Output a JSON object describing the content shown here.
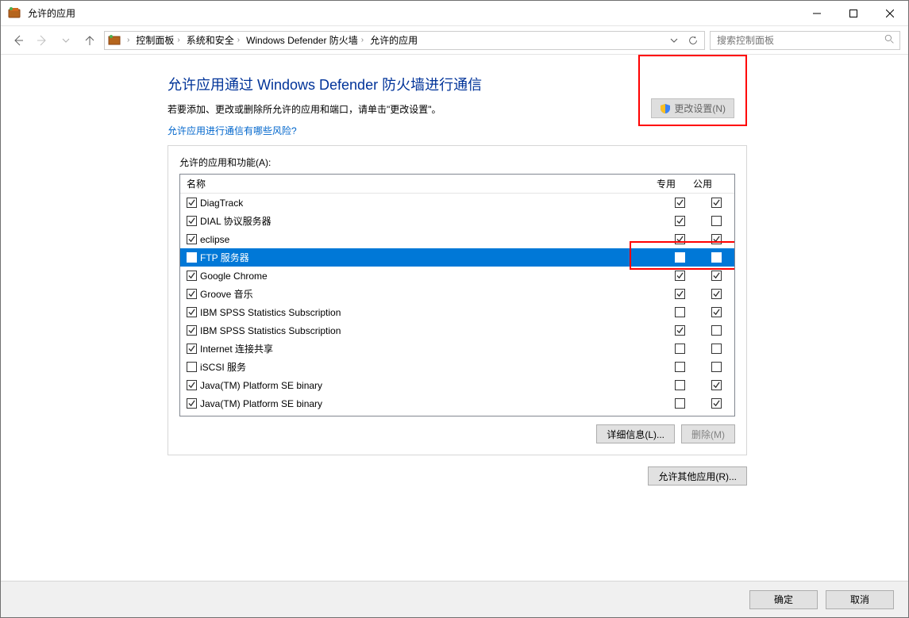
{
  "window": {
    "title": "允许的应用"
  },
  "nav": {
    "breadcrumbs": [
      "控制面板",
      "系统和安全",
      "Windows Defender 防火墙",
      "允许的应用"
    ],
    "search_placeholder": "搜索控制面板"
  },
  "page": {
    "title": "允许应用通过 Windows Defender 防火墙进行通信",
    "subtitle": "若要添加、更改或删除所允许的应用和端口，请单击\"更改设置\"。",
    "risk_link": "允许应用进行通信有哪些风险?",
    "change_settings": "更改设置(N)"
  },
  "group": {
    "label": "允许的应用和功能(A):",
    "columns": {
      "name": "名称",
      "private": "专用",
      "public": "公用"
    },
    "details_btn": "详细信息(L)...",
    "remove_btn": "删除(M)",
    "allow_other_btn": "允许其他应用(R)...",
    "rows": [
      {
        "enabled": true,
        "name": "DiagTrack",
        "private": true,
        "public": true,
        "selected": false
      },
      {
        "enabled": true,
        "name": "DIAL 协议服务器",
        "private": true,
        "public": false,
        "selected": false
      },
      {
        "enabled": true,
        "name": "eclipse",
        "private": true,
        "public": true,
        "selected": false
      },
      {
        "enabled": true,
        "name": "FTP 服务器",
        "private": true,
        "public": true,
        "selected": true
      },
      {
        "enabled": true,
        "name": "Google Chrome",
        "private": true,
        "public": true,
        "selected": false
      },
      {
        "enabled": true,
        "name": "Groove 音乐",
        "private": true,
        "public": true,
        "selected": false
      },
      {
        "enabled": true,
        "name": "IBM SPSS Statistics Subscription",
        "private": false,
        "public": true,
        "selected": false
      },
      {
        "enabled": true,
        "name": "IBM SPSS Statistics Subscription",
        "private": true,
        "public": false,
        "selected": false
      },
      {
        "enabled": true,
        "name": "Internet 连接共享",
        "private": false,
        "public": false,
        "selected": false
      },
      {
        "enabled": false,
        "name": "iSCSI 服务",
        "private": false,
        "public": false,
        "selected": false
      },
      {
        "enabled": true,
        "name": "Java(TM) Platform SE binary",
        "private": false,
        "public": true,
        "selected": false
      },
      {
        "enabled": true,
        "name": "Java(TM) Platform SE binary",
        "private": false,
        "public": true,
        "selected": false
      }
    ]
  },
  "footer": {
    "ok": "确定",
    "cancel": "取消"
  }
}
